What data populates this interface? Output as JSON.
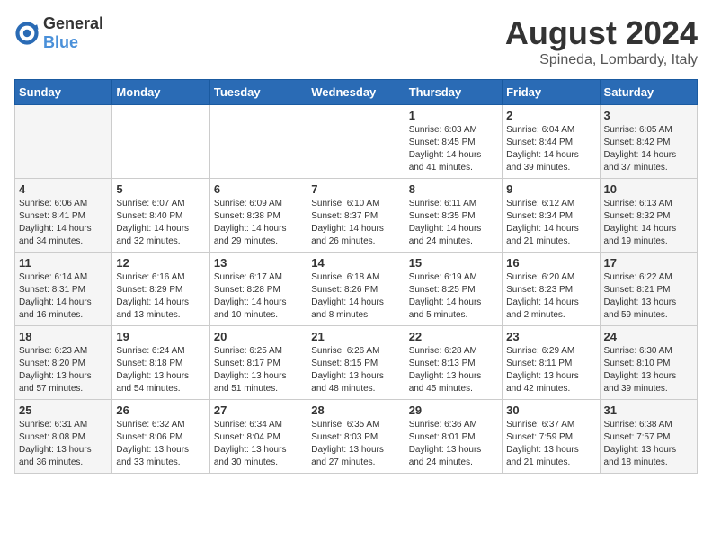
{
  "logo": {
    "general": "General",
    "blue": "Blue"
  },
  "title": "August 2024",
  "subtitle": "Spineda, Lombardy, Italy",
  "weekdays": [
    "Sunday",
    "Monday",
    "Tuesday",
    "Wednesday",
    "Thursday",
    "Friday",
    "Saturday"
  ],
  "weeks": [
    [
      {
        "day": "",
        "info": ""
      },
      {
        "day": "",
        "info": ""
      },
      {
        "day": "",
        "info": ""
      },
      {
        "day": "",
        "info": ""
      },
      {
        "day": "1",
        "info": "Sunrise: 6:03 AM\nSunset: 8:45 PM\nDaylight: 14 hours and 41 minutes."
      },
      {
        "day": "2",
        "info": "Sunrise: 6:04 AM\nSunset: 8:44 PM\nDaylight: 14 hours and 39 minutes."
      },
      {
        "day": "3",
        "info": "Sunrise: 6:05 AM\nSunset: 8:42 PM\nDaylight: 14 hours and 37 minutes."
      }
    ],
    [
      {
        "day": "4",
        "info": "Sunrise: 6:06 AM\nSunset: 8:41 PM\nDaylight: 14 hours and 34 minutes."
      },
      {
        "day": "5",
        "info": "Sunrise: 6:07 AM\nSunset: 8:40 PM\nDaylight: 14 hours and 32 minutes."
      },
      {
        "day": "6",
        "info": "Sunrise: 6:09 AM\nSunset: 8:38 PM\nDaylight: 14 hours and 29 minutes."
      },
      {
        "day": "7",
        "info": "Sunrise: 6:10 AM\nSunset: 8:37 PM\nDaylight: 14 hours and 26 minutes."
      },
      {
        "day": "8",
        "info": "Sunrise: 6:11 AM\nSunset: 8:35 PM\nDaylight: 14 hours and 24 minutes."
      },
      {
        "day": "9",
        "info": "Sunrise: 6:12 AM\nSunset: 8:34 PM\nDaylight: 14 hours and 21 minutes."
      },
      {
        "day": "10",
        "info": "Sunrise: 6:13 AM\nSunset: 8:32 PM\nDaylight: 14 hours and 19 minutes."
      }
    ],
    [
      {
        "day": "11",
        "info": "Sunrise: 6:14 AM\nSunset: 8:31 PM\nDaylight: 14 hours and 16 minutes."
      },
      {
        "day": "12",
        "info": "Sunrise: 6:16 AM\nSunset: 8:29 PM\nDaylight: 14 hours and 13 minutes."
      },
      {
        "day": "13",
        "info": "Sunrise: 6:17 AM\nSunset: 8:28 PM\nDaylight: 14 hours and 10 minutes."
      },
      {
        "day": "14",
        "info": "Sunrise: 6:18 AM\nSunset: 8:26 PM\nDaylight: 14 hours and 8 minutes."
      },
      {
        "day": "15",
        "info": "Sunrise: 6:19 AM\nSunset: 8:25 PM\nDaylight: 14 hours and 5 minutes."
      },
      {
        "day": "16",
        "info": "Sunrise: 6:20 AM\nSunset: 8:23 PM\nDaylight: 14 hours and 2 minutes."
      },
      {
        "day": "17",
        "info": "Sunrise: 6:22 AM\nSunset: 8:21 PM\nDaylight: 13 hours and 59 minutes."
      }
    ],
    [
      {
        "day": "18",
        "info": "Sunrise: 6:23 AM\nSunset: 8:20 PM\nDaylight: 13 hours and 57 minutes."
      },
      {
        "day": "19",
        "info": "Sunrise: 6:24 AM\nSunset: 8:18 PM\nDaylight: 13 hours and 54 minutes."
      },
      {
        "day": "20",
        "info": "Sunrise: 6:25 AM\nSunset: 8:17 PM\nDaylight: 13 hours and 51 minutes."
      },
      {
        "day": "21",
        "info": "Sunrise: 6:26 AM\nSunset: 8:15 PM\nDaylight: 13 hours and 48 minutes."
      },
      {
        "day": "22",
        "info": "Sunrise: 6:28 AM\nSunset: 8:13 PM\nDaylight: 13 hours and 45 minutes."
      },
      {
        "day": "23",
        "info": "Sunrise: 6:29 AM\nSunset: 8:11 PM\nDaylight: 13 hours and 42 minutes."
      },
      {
        "day": "24",
        "info": "Sunrise: 6:30 AM\nSunset: 8:10 PM\nDaylight: 13 hours and 39 minutes."
      }
    ],
    [
      {
        "day": "25",
        "info": "Sunrise: 6:31 AM\nSunset: 8:08 PM\nDaylight: 13 hours and 36 minutes."
      },
      {
        "day": "26",
        "info": "Sunrise: 6:32 AM\nSunset: 8:06 PM\nDaylight: 13 hours and 33 minutes."
      },
      {
        "day": "27",
        "info": "Sunrise: 6:34 AM\nSunset: 8:04 PM\nDaylight: 13 hours and 30 minutes."
      },
      {
        "day": "28",
        "info": "Sunrise: 6:35 AM\nSunset: 8:03 PM\nDaylight: 13 hours and 27 minutes."
      },
      {
        "day": "29",
        "info": "Sunrise: 6:36 AM\nSunset: 8:01 PM\nDaylight: 13 hours and 24 minutes."
      },
      {
        "day": "30",
        "info": "Sunrise: 6:37 AM\nSunset: 7:59 PM\nDaylight: 13 hours and 21 minutes."
      },
      {
        "day": "31",
        "info": "Sunrise: 6:38 AM\nSunset: 7:57 PM\nDaylight: 13 hours and 18 minutes."
      }
    ]
  ]
}
